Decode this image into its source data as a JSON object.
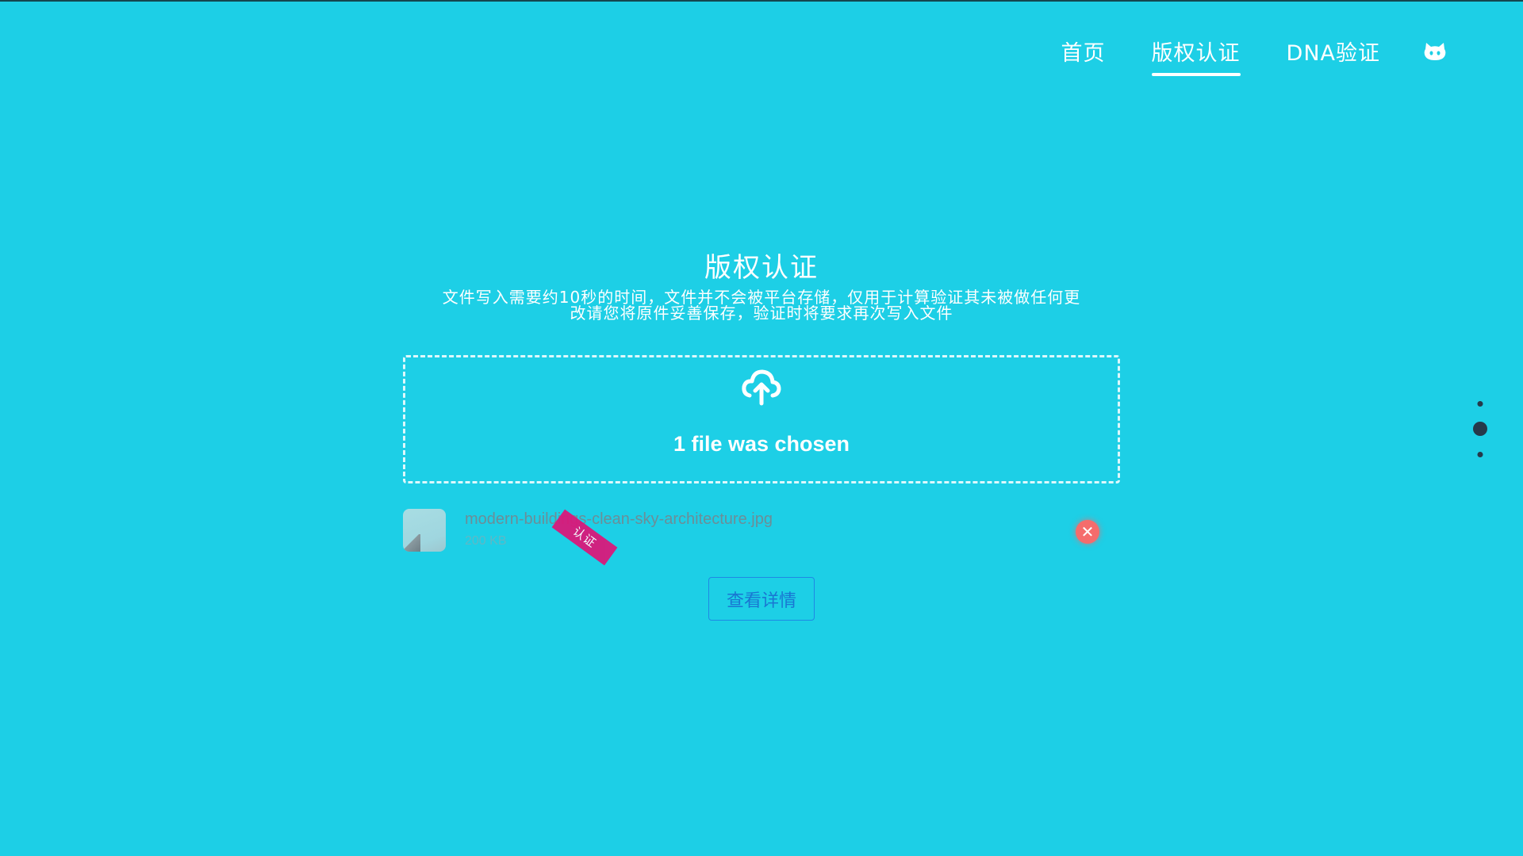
{
  "nav": {
    "items": [
      {
        "label": "首页",
        "active": false
      },
      {
        "label": "版权认证",
        "active": true
      },
      {
        "label": "DNA验证",
        "active": false
      }
    ],
    "github_icon": "github-icon"
  },
  "main": {
    "title": "版权认证",
    "description_line1": "文件写入需要约10秒的时间，文件并不会被平台存储，仅用于计算验证其未被做任何更",
    "description_line2": "改请您将原件妥善保存，验证时将要求再次写入文件"
  },
  "upload": {
    "icon": "cloud-upload-icon",
    "status_text": "1 file was chosen"
  },
  "file": {
    "name": "modern-buildings-clean-sky-architecture.jpg",
    "size": "200 KB",
    "stamp_text": "认证"
  },
  "actions": {
    "details_label": "查看详情"
  },
  "pager": {
    "dots": 3,
    "active_index": 1
  },
  "colors": {
    "background": "#1dcfe6",
    "remove_button": "#f56c6c",
    "stamp": "#d9197b",
    "details_border": "#1e88e5",
    "pager_dot": "#26394a"
  }
}
